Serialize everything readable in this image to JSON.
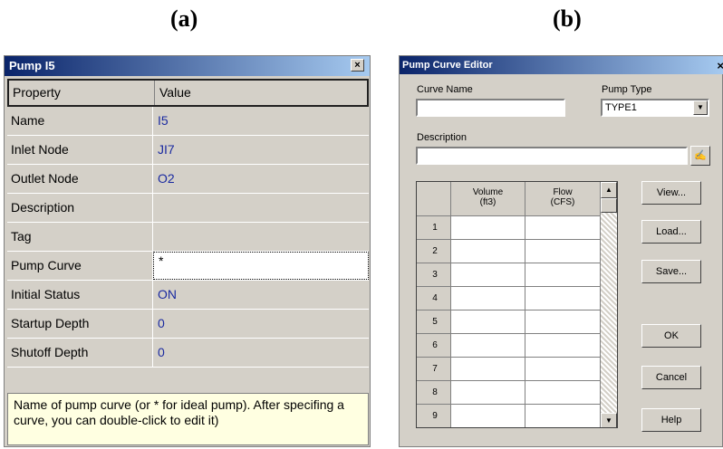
{
  "captions": {
    "a": "(a)",
    "b": "(b)"
  },
  "panel_a": {
    "title": "Pump I5",
    "close": "×",
    "header": {
      "property": "Property",
      "value": "Value"
    },
    "rows": [
      {
        "property": "Name",
        "value": "I5"
      },
      {
        "property": "Inlet Node",
        "value": "JI7"
      },
      {
        "property": "Outlet Node",
        "value": "O2"
      },
      {
        "property": "Description",
        "value": ""
      },
      {
        "property": "Tag",
        "value": ""
      },
      {
        "property": "Pump Curve",
        "value": "*"
      },
      {
        "property": "Initial Status",
        "value": "ON"
      },
      {
        "property": "Startup Depth",
        "value": "0"
      },
      {
        "property": "Shutoff Depth",
        "value": "0"
      }
    ],
    "help_text": "Name of pump curve (or * for ideal pump). After specifing a curve, you can double-click to edit it)"
  },
  "panel_b": {
    "title": "Pump Curve Editor",
    "close": "×",
    "curve_name_label": "Curve Name",
    "curve_name_value": "",
    "pump_type_label": "Pump Type",
    "pump_type_value": "TYPE1",
    "description_label": "Description",
    "description_value": "",
    "col_volume": "Volume",
    "col_volume_unit": "(ft3)",
    "col_flow": "Flow",
    "col_flow_unit": "(CFS)",
    "row_numbers": [
      "1",
      "2",
      "3",
      "4",
      "5",
      "6",
      "7",
      "8",
      "9"
    ],
    "buttons": {
      "view": "View...",
      "load": "Load...",
      "save": "Save...",
      "ok": "OK",
      "cancel": "Cancel",
      "help": "Help"
    }
  }
}
